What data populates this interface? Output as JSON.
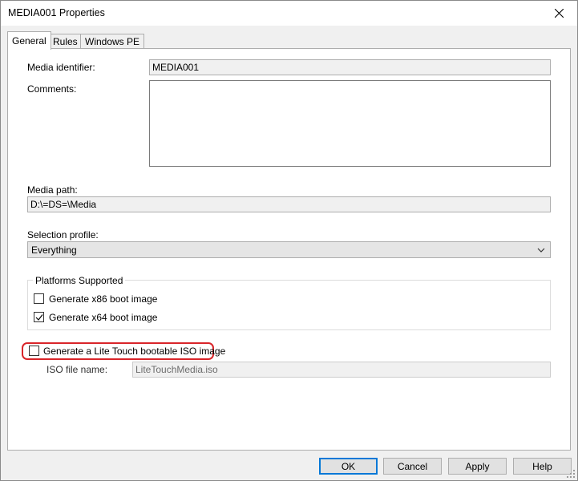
{
  "window": {
    "title": "MEDIA001 Properties"
  },
  "tabs": [
    {
      "label": "General",
      "active": true
    },
    {
      "label": "Rules",
      "active": false
    },
    {
      "label": "Windows PE",
      "active": false
    }
  ],
  "general": {
    "media_identifier_label": "Media identifier:",
    "media_identifier_value": "MEDIA001",
    "comments_label": "Comments:",
    "comments_value": "",
    "media_path_label": "Media path:",
    "media_path_value": "D:\\=DS=\\Media",
    "selection_profile_label": "Selection profile:",
    "selection_profile_value": "Everything",
    "platforms_group_label": "Platforms Supported",
    "x86_label": "Generate x86 boot image",
    "x86_checked": false,
    "x64_label": "Generate x64 boot image",
    "x64_checked": true,
    "iso_label": "Generate a Lite Touch bootable ISO image",
    "iso_checked": false,
    "iso_file_label": "ISO file name:",
    "iso_file_value": "LiteTouchMedia.iso"
  },
  "buttons": {
    "ok": "OK",
    "cancel": "Cancel",
    "apply": "Apply",
    "help": "Help"
  },
  "colors": {
    "highlight": "#d9252a",
    "default_button_border": "#0078d7"
  }
}
